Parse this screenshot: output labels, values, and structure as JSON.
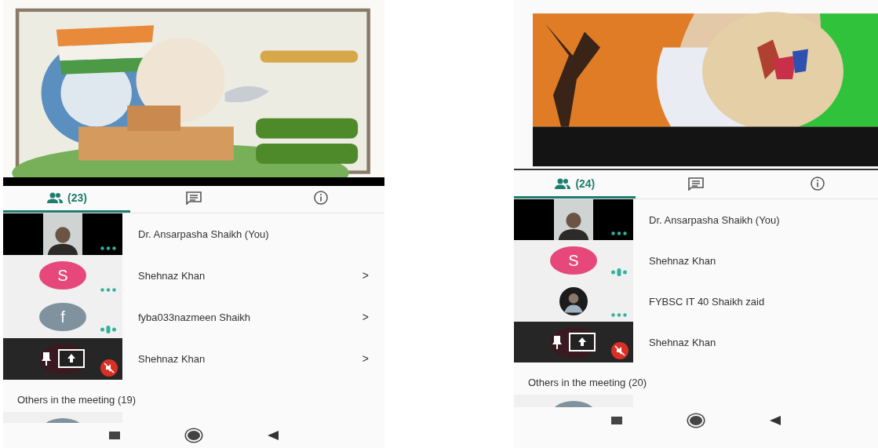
{
  "panels": [
    {
      "shared": {
        "kind": "picture"
      },
      "tabs": [
        {
          "kind": "people",
          "label": "(23)",
          "selected": true
        },
        {
          "kind": "chat",
          "selected": false
        },
        {
          "kind": "info",
          "selected": false
        }
      ],
      "participants": [
        {
          "kind": "video",
          "name": "Dr. Ansarpasha Shaikh (You)",
          "speaking": false,
          "muted": false
        },
        {
          "kind": "initial",
          "initial": "S",
          "color": "#e6487b",
          "name": "Shehnaz Khan",
          "speaking": false,
          "muted": false,
          "chevron": ">"
        },
        {
          "kind": "initial",
          "initial": "f",
          "color": "#7f929d",
          "name": "fyba033nazmeen Shaikh",
          "speaking": true,
          "muted": false,
          "chevron": ">"
        },
        {
          "kind": "presenting",
          "name": "Shehnaz Khan",
          "muted": true,
          "chevron": ">"
        }
      ],
      "others_heading": "Others in the meeting (19)"
    },
    {
      "shared": {
        "kind": "picture"
      },
      "tabs": [
        {
          "kind": "people",
          "label": "(24)",
          "selected": true
        },
        {
          "kind": "chat",
          "selected": false
        },
        {
          "kind": "info",
          "selected": false
        }
      ],
      "participants": [
        {
          "kind": "video",
          "name": "Dr. Ansarpasha Shaikh (You)",
          "speaking": false,
          "muted": false
        },
        {
          "kind": "initial",
          "initial": "S",
          "color": "#e6487b",
          "name": "Shehnaz Khan",
          "speaking": true,
          "muted": false
        },
        {
          "name": "FYBSC IT 40 Shaikh zaid",
          "speaking": false,
          "muted": false
        },
        {
          "kind": "presenting",
          "name": "Shehnaz Khan",
          "muted": true
        }
      ],
      "others_heading": "Others in the meeting (20)"
    }
  ]
}
